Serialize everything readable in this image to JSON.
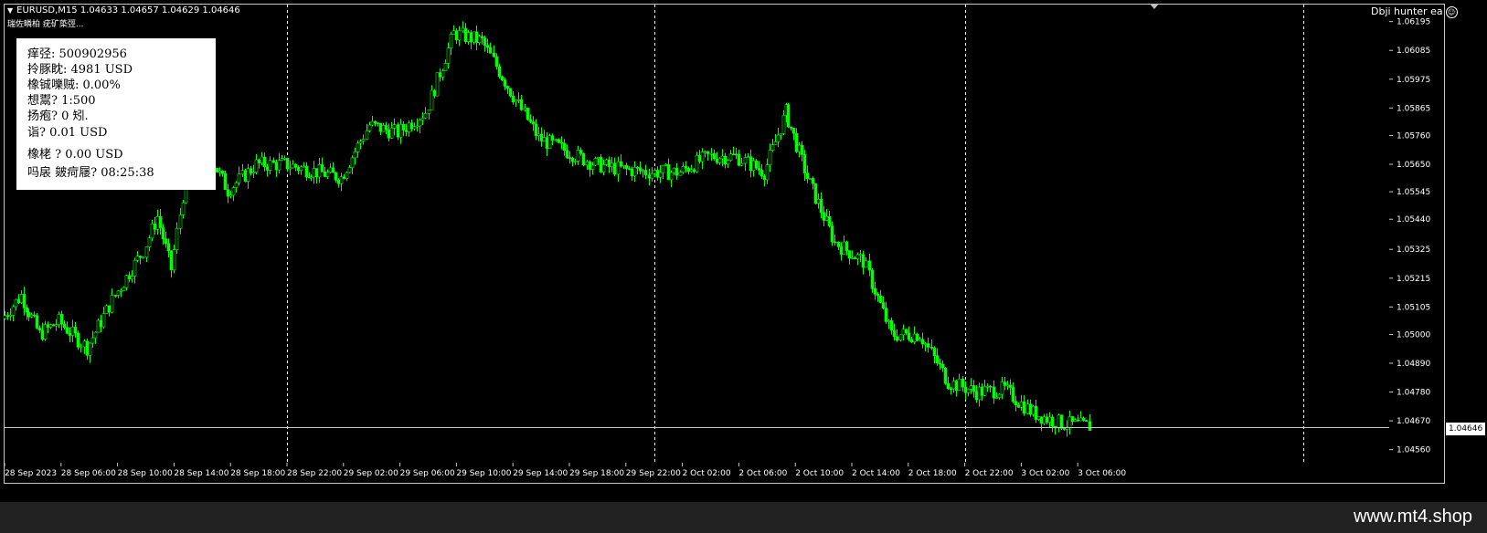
{
  "header": {
    "symbol_line": "EURUSD,M15  1.04633 1.04657 1.04629 1.04646",
    "indicator_name": "瑞佐疄柏 疣矿蒅弳...",
    "ea_name": "Dbji hunter ea"
  },
  "info_panel": {
    "rows": [
      "痒弪: 500902956",
      "拎豚眈: 4981 USD",
      "橡铖嚛贼: 0.00%",
      "想鬻? 1:500",
      "扬疱? 0 矧.",
      "诣? 0.01 USD",
      "橡栳    ? 0.00 USD",
      "吗扆     皴疴屦? 08:25:38"
    ]
  },
  "price_tag": "1.04646",
  "watermark": "www.mt4.shop",
  "colors": {
    "background": "#000000",
    "candle": "#00ff00",
    "frame": "#c8c8c8",
    "current_price_line": "#c8c8c8",
    "session_separator": "#ffffff"
  },
  "chart_data": {
    "type": "candlestick",
    "symbol": "EURUSD",
    "timeframe": "M15",
    "last_quote": {
      "open": 1.04633,
      "high": 1.04657,
      "low": 1.04629,
      "close": 1.04646
    },
    "ylim": [
      1.0451,
      1.0626
    ],
    "y_ticks": [
      "1.06195",
      "1.06085",
      "1.05975",
      "1.05865",
      "1.05760",
      "1.05650",
      "1.05545",
      "1.05440",
      "1.05325",
      "1.05215",
      "1.05105",
      "1.05000",
      "1.04890",
      "1.04780",
      "1.04670",
      "1.04560"
    ],
    "x_ticks": [
      "28 Sep 2023",
      "28 Sep 06:00",
      "28 Sep 10:00",
      "28 Sep 14:00",
      "28 Sep 18:00",
      "28 Sep 22:00",
      "29 Sep 02:00",
      "29 Sep 06:00",
      "29 Sep 10:00",
      "29 Sep 14:00",
      "29 Sep 18:00",
      "29 Sep 22:00",
      "2 Oct 02:00",
      "2 Oct 06:00",
      "2 Oct 10:00",
      "2 Oct 14:00",
      "2 Oct 18:00",
      "2 Oct 22:00",
      "3 Oct 02:00",
      "3 Oct 06:00"
    ],
    "day_separators": [
      "28 Sep 22:00",
      "2 Oct 00:00",
      "2 Oct 22:00",
      "3 Oct 22:00"
    ],
    "current_price": 1.04646,
    "close_path": [
      {
        "t": "28 Sep 2023",
        "close": 1.0506
      },
      {
        "t": "28 Sep 02:00",
        "close": 1.0515
      },
      {
        "t": "28 Sep 04:00",
        "close": 1.05
      },
      {
        "t": "28 Sep 06:00",
        "close": 1.0505
      },
      {
        "t": "28 Sep 08:00",
        "close": 1.0495
      },
      {
        "t": "28 Sep 10:00",
        "close": 1.0515
      },
      {
        "t": "28 Sep 12:00",
        "close": 1.0532
      },
      {
        "t": "28 Sep 13:00",
        "close": 1.0545
      },
      {
        "t": "28 Sep 14:00",
        "close": 1.0525
      },
      {
        "t": "28 Sep 15:00",
        "close": 1.056
      },
      {
        "t": "28 Sep 16:00",
        "close": 1.0575
      },
      {
        "t": "28 Sep 18:00",
        "close": 1.0555
      },
      {
        "t": "28 Sep 20:00",
        "close": 1.0565
      },
      {
        "t": "28 Sep 22:00",
        "close": 1.0565
      },
      {
        "t": "29 Sep 02:00",
        "close": 1.056
      },
      {
        "t": "29 Sep 04:00",
        "close": 1.058
      },
      {
        "t": "29 Sep 06:00",
        "close": 1.0577
      },
      {
        "t": "29 Sep 08:00",
        "close": 1.0585
      },
      {
        "t": "29 Sep 10:00",
        "close": 1.0615
      },
      {
        "t": "29 Sep 12:00",
        "close": 1.0612
      },
      {
        "t": "29 Sep 14:00",
        "close": 1.0593
      },
      {
        "t": "29 Sep 16:00",
        "close": 1.0575
      },
      {
        "t": "29 Sep 18:00",
        "close": 1.057
      },
      {
        "t": "29 Sep 20:00",
        "close": 1.0565
      },
      {
        "t": "29 Sep 22:00",
        "close": 1.0563
      },
      {
        "t": "2 Oct 00:00",
        "close": 1.0562
      },
      {
        "t": "2 Oct 02:00",
        "close": 1.0562
      },
      {
        "t": "2 Oct 04:00",
        "close": 1.0568
      },
      {
        "t": "2 Oct 06:00",
        "close": 1.0568
      },
      {
        "t": "2 Oct 08:00",
        "close": 1.0562
      },
      {
        "t": "2 Oct 09:30",
        "close": 1.0585
      },
      {
        "t": "2 Oct 11:00",
        "close": 1.056
      },
      {
        "t": "2 Oct 13:00",
        "close": 1.0535
      },
      {
        "t": "2 Oct 15:00",
        "close": 1.0528
      },
      {
        "t": "2 Oct 17:00",
        "close": 1.05
      },
      {
        "t": "2 Oct 19:00",
        "close": 1.05
      },
      {
        "t": "2 Oct 21:00",
        "close": 1.0482
      },
      {
        "t": "2 Oct 23:00",
        "close": 1.0478
      },
      {
        "t": "3 Oct 01:00",
        "close": 1.0479
      },
      {
        "t": "3 Oct 03:00",
        "close": 1.047
      },
      {
        "t": "3 Oct 05:00",
        "close": 1.0466
      },
      {
        "t": "3 Oct 07:00",
        "close": 1.0465
      }
    ]
  }
}
